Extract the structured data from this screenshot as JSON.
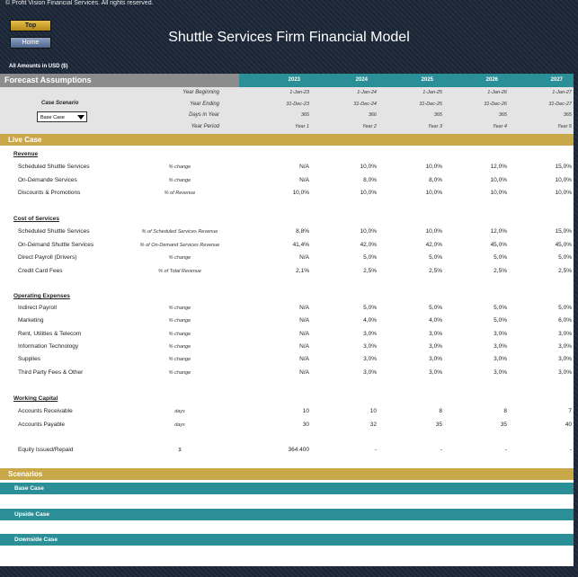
{
  "copyright": "© Profit Vision Financial Services. All rights reserved.",
  "nav": {
    "top_label": "Top",
    "home_label": "Home"
  },
  "title": "Shuttle Services Firm Financial Model",
  "amounts_note": "All Amounts in  USD ($)",
  "forecast_label": "Forecast Assumptions",
  "years": [
    "2023",
    "2024",
    "2025",
    "2026",
    "2027"
  ],
  "timeline": {
    "labels": [
      "Year Beginning",
      "Year Ending",
      "Days in Year",
      "Year Period"
    ],
    "year_beginning": [
      "1-Jan-23",
      "1-Jan-24",
      "1-Jan-25",
      "1-Jan-26",
      "1-Jan-27"
    ],
    "year_ending": [
      "31-Dec-23",
      "31-Dec-24",
      "31-Dec-25",
      "31-Dec-26",
      "31-Dec-27"
    ],
    "days_in_year": [
      "365",
      "366",
      "365",
      "365",
      "365"
    ],
    "year_period": [
      "Year 1",
      "Year 2",
      "Year 3",
      "Year 4",
      "Year 5"
    ]
  },
  "case_scenario": {
    "label": "Case Scenario",
    "selected": "Base Case"
  },
  "live_case_label": "Live Case",
  "revenue": {
    "heading": "Revenue",
    "rows": [
      {
        "label": "Scheduled Shuttle Services",
        "unit": "% change",
        "values": [
          "N/A",
          "10,0%",
          "10,0%",
          "12,0%",
          "15,0%"
        ]
      },
      {
        "label": "On-Demande Services",
        "unit": "% change",
        "values": [
          "N/A",
          "8,0%",
          "8,0%",
          "10,0%",
          "10,0%"
        ]
      },
      {
        "label": "Discounts & Promotions",
        "unit": "% of Revenue",
        "values": [
          "10,0%",
          "10,0%",
          "10,0%",
          "10,0%",
          "10,0%"
        ]
      }
    ]
  },
  "cost_of_services": {
    "heading": "Cost of Services",
    "rows": [
      {
        "label": "Scheduled Shuttle Services",
        "unit": "% of Scheduled Services Revenue",
        "values": [
          "8,8%",
          "10,0%",
          "10,0%",
          "12,0%",
          "15,0%"
        ]
      },
      {
        "label": "On-Demand Shuttle Services",
        "unit": "% of On-Demand Services Revenue",
        "values": [
          "41,4%",
          "42,0%",
          "42,0%",
          "45,0%",
          "45,0%"
        ]
      },
      {
        "label": "Direct Payroll (Drivers)",
        "unit": "% change",
        "values": [
          "N/A",
          "5,0%",
          "5,0%",
          "5,0%",
          "5,0%"
        ]
      },
      {
        "label": "Credit Card Fees",
        "unit": "% of Total Revenue",
        "values": [
          "2,1%",
          "2,5%",
          "2,5%",
          "2,5%",
          "2,5%"
        ]
      }
    ]
  },
  "operating_expenses": {
    "heading": "Operating Expenses",
    "rows": [
      {
        "label": "Indirect Payroll",
        "unit": "% change",
        "values": [
          "N/A",
          "5,0%",
          "5,0%",
          "5,0%",
          "5,0%"
        ]
      },
      {
        "label": "Marketing",
        "unit": "% change",
        "values": [
          "N/A",
          "4,0%",
          "4,0%",
          "5,0%",
          "6,0%"
        ]
      },
      {
        "label": "Rent, Utilities & Telecom",
        "unit": "% change",
        "values": [
          "N/A",
          "3,0%",
          "3,0%",
          "3,0%",
          "3,0%"
        ]
      },
      {
        "label": "Information Technology",
        "unit": "% change",
        "values": [
          "N/A",
          "3,0%",
          "3,0%",
          "3,0%",
          "3,0%"
        ]
      },
      {
        "label": "Supplies",
        "unit": "% change",
        "values": [
          "N/A",
          "3,0%",
          "3,0%",
          "3,0%",
          "3,0%"
        ]
      },
      {
        "label": "Third Party Fees & Other",
        "unit": "% change",
        "values": [
          "N/A",
          "3,0%",
          "3,0%",
          "3,0%",
          "3,0%"
        ]
      }
    ]
  },
  "working_capital": {
    "heading": "Working Capital",
    "rows": [
      {
        "label": "Accounts Receivable",
        "unit": "days",
        "values": [
          "10",
          "10",
          "8",
          "8",
          "7"
        ]
      },
      {
        "label": "Accounts Payable",
        "unit": "days",
        "values": [
          "30",
          "32",
          "35",
          "35",
          "40"
        ]
      }
    ]
  },
  "equity": {
    "label": "Equity Issued/Repaid",
    "unit": "$",
    "values": [
      "364.400",
      "-",
      "-",
      "-",
      "-"
    ]
  },
  "scenarios": {
    "label": "Scenarios",
    "items": [
      "Base Case",
      "Upside Case",
      "Downside Case"
    ]
  },
  "colors": {
    "teal": "#2a8f96",
    "gold": "#c9a84a",
    "gray_header": "#8c8c8c",
    "background": "#1b2533"
  }
}
